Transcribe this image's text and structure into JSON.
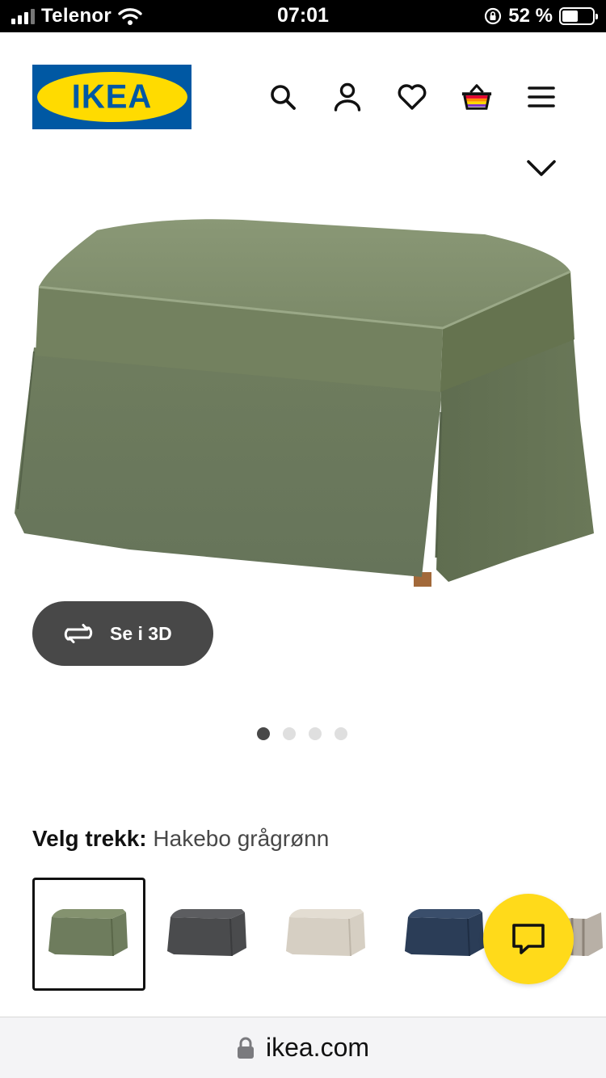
{
  "status_bar": {
    "carrier": "Telenor",
    "time": "07:01",
    "battery_percent": "52 %"
  },
  "header": {
    "logo_text": "IKEA",
    "icons": [
      "search-icon",
      "account-icon",
      "favorites-icon",
      "cart-icon",
      "menu-icon"
    ]
  },
  "gallery": {
    "view_3d_label": "Se i 3D",
    "image_count": 4,
    "active_image": 1,
    "product_color": "#6e7c5d"
  },
  "cover": {
    "label": "Velg trekk:",
    "selected_value": "Hakebo grågrønn",
    "swatches": [
      {
        "color": "#6e7c5d",
        "selected": true
      },
      {
        "color": "#4a4b4d",
        "selected": false
      },
      {
        "color": "#d6cfc3",
        "selected": false
      },
      {
        "color": "#2b3d57",
        "selected": false
      },
      {
        "color": "#9c938a",
        "selected": false
      }
    ]
  },
  "chat": {
    "icon": "chat-icon",
    "color": "#ffda1a"
  },
  "browser": {
    "url": "ikea.com"
  },
  "colors": {
    "ikea_blue": "#0058a3",
    "ikea_yellow": "#ffdb00",
    "dark_button": "#484848"
  }
}
